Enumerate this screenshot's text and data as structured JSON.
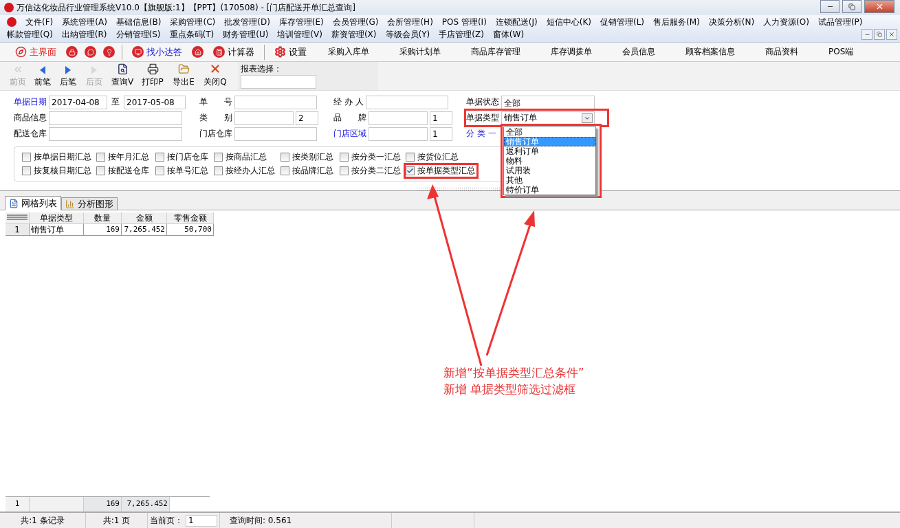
{
  "window": {
    "title": "万信达化妆品行业管理系统V10.0【旗舰版:1】【PPT】(170508) - [门店配送开单汇总查询]"
  },
  "menu_rows": [
    [
      "文件(F)",
      "系统管理(A)",
      "基础信息(B)",
      "采购管理(C)",
      "批发管理(D)",
      "库存管理(E)",
      "会员管理(G)",
      "会所管理(H)",
      "POS 管理(I)",
      "连锁配送(J)",
      "短信中心(K)",
      "促销管理(L)",
      "售后服务(M)",
      "决策分析(N)",
      "人力资源(O)",
      "试品管理(P)"
    ],
    [
      "帐款管理(Q)",
      "出纳管理(R)",
      "分销管理(S)",
      "重点条码(T)",
      "财务管理(U)",
      "培训管理(V)",
      "薪资管理(X)",
      "等级会员(Y)",
      "手店管理(Z)",
      "窗体(W)"
    ]
  ],
  "quick_toolbar": {
    "main": "主界面",
    "helper": "找小达答",
    "calculator": "计算器",
    "settings": "设置",
    "shortcuts": [
      "采购入库单",
      "采购计划单",
      "商品库存管理",
      "库存调拨单",
      "会员信息",
      "顾客档案信息",
      "商品资料",
      "POS端"
    ]
  },
  "report_toolbar": {
    "buttons": [
      {
        "label": "前页",
        "disabled": true
      },
      {
        "label": "前笔",
        "disabled": false
      },
      {
        "label": "后笔",
        "disabled": false
      },
      {
        "label": "后页",
        "disabled": true
      },
      {
        "label": "查询V",
        "disabled": false
      },
      {
        "label": "打印P",
        "disabled": false
      },
      {
        "label": "导出E",
        "disabled": false
      },
      {
        "label": "关闭Q",
        "disabled": false
      }
    ],
    "report_select_label": "报表选择："
  },
  "filters": {
    "date": {
      "label": "单据日期",
      "link": true,
      "from": "2017-04-08",
      "to_label": "至",
      "to": "2017-05-08"
    },
    "product": {
      "label": "商品信息",
      "link": false
    },
    "delivery_warehouse": {
      "label": "配送仓库",
      "link": false
    },
    "order_no": {
      "label": "单　　号",
      "link": false
    },
    "category": {
      "label": "类　　别",
      "link": false,
      "code": "2"
    },
    "store_warehouse": {
      "label": "门店仓库",
      "link": false
    },
    "handler": {
      "label": "经 办 人",
      "link": false
    },
    "brand": {
      "label": "品　　牌",
      "link": false,
      "code": "1"
    },
    "store_area": {
      "label": "门店区域",
      "link": true,
      "code": "1"
    },
    "status": {
      "label": "单据状态",
      "link": false,
      "value": "全部"
    },
    "order_type": {
      "label": "单据类型",
      "link": false,
      "value": "销售订单",
      "expanded": true,
      "highlighted": true,
      "options": [
        {
          "label": "全部",
          "selected": false
        },
        {
          "label": "销售订单",
          "selected": true
        },
        {
          "label": "返利订单",
          "selected": false
        },
        {
          "label": "物料",
          "selected": false
        },
        {
          "label": "试用装",
          "selected": false
        },
        {
          "label": "其他",
          "selected": false
        },
        {
          "label": "特价订单",
          "selected": false
        }
      ]
    },
    "class_one": {
      "label": "分 类 一",
      "link": true
    }
  },
  "summary_options": [
    {
      "label": "按单据日期汇总",
      "checked": false,
      "highlighted": false
    },
    {
      "label": "按年月汇总",
      "checked": false,
      "highlighted": false
    },
    {
      "label": "按门店仓库",
      "checked": false,
      "highlighted": false
    },
    {
      "label": "按商品汇总",
      "checked": false,
      "highlighted": false
    },
    {
      "label": "按类别汇总",
      "checked": false,
      "highlighted": false
    },
    {
      "label": "按分类一汇总",
      "checked": false,
      "highlighted": false
    },
    {
      "label": "按货位汇总",
      "checked": false,
      "highlighted": false
    },
    {
      "label": "按复核日期汇总",
      "checked": false,
      "highlighted": false
    },
    {
      "label": "按配送仓库",
      "checked": false,
      "highlighted": false
    },
    {
      "label": "按单号汇总",
      "checked": false,
      "highlighted": false
    },
    {
      "label": "按经办人汇总",
      "checked": false,
      "highlighted": false
    },
    {
      "label": "按品牌汇总",
      "checked": false,
      "highlighted": false
    },
    {
      "label": "按分类二汇总",
      "checked": false,
      "highlighted": false
    },
    {
      "label": "按单据类型汇总",
      "checked": true,
      "highlighted": true
    }
  ],
  "tabs": [
    {
      "label": "网格列表",
      "selected": true
    },
    {
      "label": "分析图形",
      "selected": false
    }
  ],
  "table": {
    "columns": [
      "单据类型",
      "数量",
      "金额",
      "零售金额"
    ],
    "rows": [
      {
        "index": "1",
        "cells": [
          "销售订单",
          "169",
          "7,265.452",
          "50,700"
        ]
      }
    ]
  },
  "totals": {
    "index": "1",
    "quantity": "169",
    "amount": "7,265.452"
  },
  "status_bar": {
    "records": "共:1 条记录",
    "pages": "共:1 页",
    "page_label": "当前页：",
    "page": "1",
    "query_time": "查询时间: 0.561"
  },
  "annotation": {
    "lines": [
      "新增“按单据类型汇总条件”",
      "新增  单据类型筛选过滤框"
    ]
  }
}
